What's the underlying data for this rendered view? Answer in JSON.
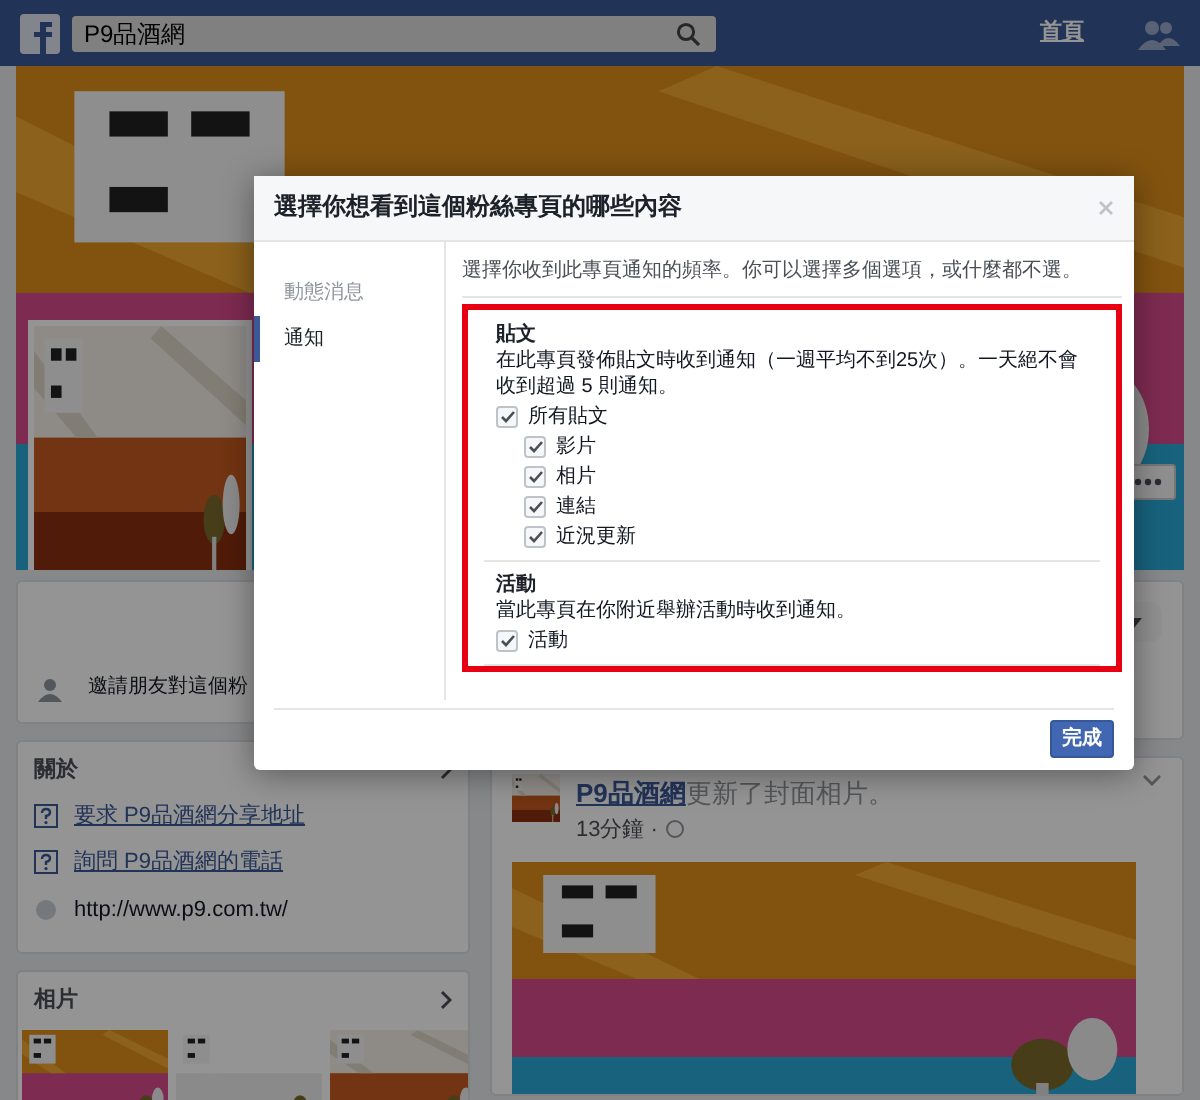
{
  "top_bar": {
    "search": {
      "value": "P9品酒網"
    },
    "home_link": "首頁"
  },
  "left_column": {
    "invite_text": "邀請朋友對這個粉",
    "about": {
      "title": "關於",
      "items": [
        {
          "kind": "question",
          "text": "要求 P9品酒網分享地址"
        },
        {
          "kind": "question",
          "text": "詢問 P9品酒網的電話"
        },
        {
          "kind": "website",
          "text": "http://www.p9.com.tw/"
        }
      ]
    },
    "photos": {
      "title": "相片"
    }
  },
  "post": {
    "author": "P9品酒網",
    "action": "更新了封面相片。",
    "time": "13分鐘 ·"
  },
  "dialog": {
    "title": "選擇你想看到這個粉絲專頁的哪些內容",
    "tabs": [
      {
        "label": "動態消息",
        "selected": false
      },
      {
        "label": "通知",
        "selected": true
      }
    ],
    "intro": "選擇你收到此專頁通知的頻率。你可以選擇多個選項，或什麼都不選。",
    "highlighted": true,
    "sections": [
      {
        "title": "貼文",
        "description": "在此專頁發佈貼文時收到通知（一週平均不到25次）。一天絕不會收到超過 5 則通知。",
        "options": [
          {
            "label": "所有貼文",
            "checked": true,
            "children": [
              {
                "label": "影片",
                "checked": true
              },
              {
                "label": "相片",
                "checked": true
              },
              {
                "label": "連結",
                "checked": true
              },
              {
                "label": "近況更新",
                "checked": true
              }
            ]
          }
        ]
      },
      {
        "title": "活動",
        "description": "當此專頁在你附近舉辦活動時收到通知。",
        "options": [
          {
            "label": "活動",
            "checked": true
          }
        ]
      }
    ],
    "done_button": "完成"
  }
}
